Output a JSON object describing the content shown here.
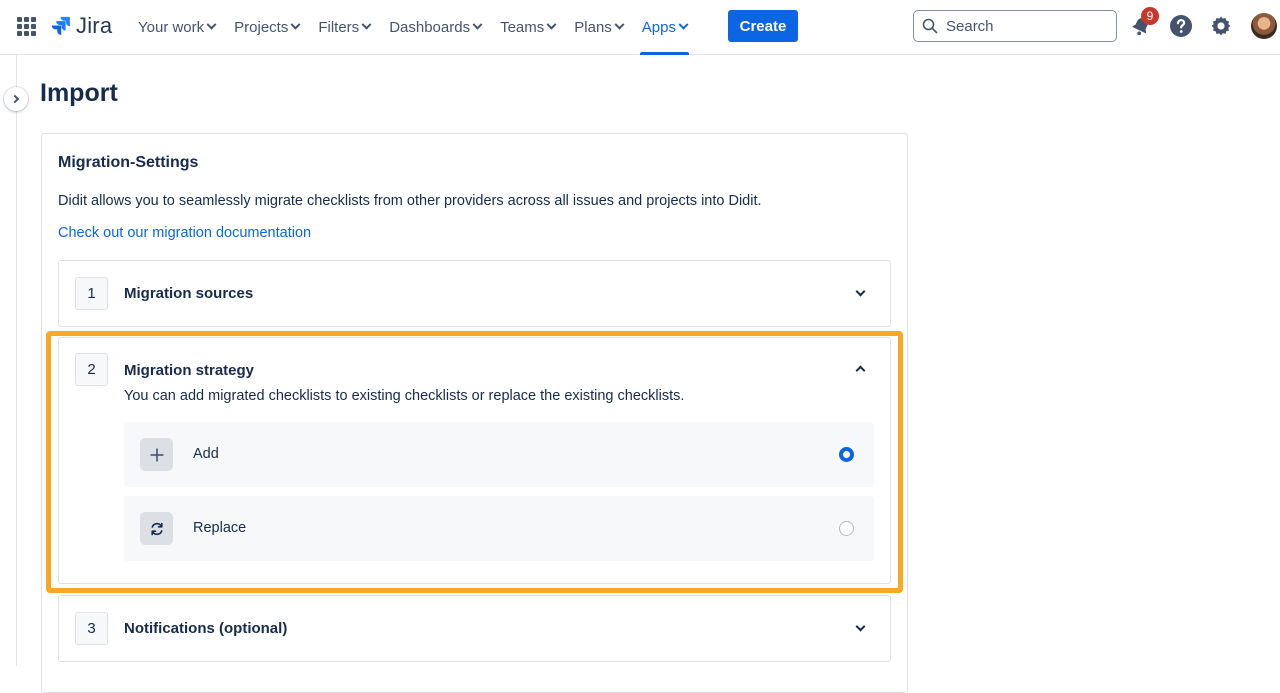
{
  "nav": {
    "apps_icon": "app-switcher-grid-icon",
    "logo_text": "Jira",
    "items": [
      {
        "label": "Your work",
        "active": false
      },
      {
        "label": "Projects",
        "active": false
      },
      {
        "label": "Filters",
        "active": false
      },
      {
        "label": "Dashboards",
        "active": false
      },
      {
        "label": "Teams",
        "active": false
      },
      {
        "label": "Plans",
        "active": false
      },
      {
        "label": "Apps",
        "active": true
      }
    ],
    "create_label": "Create",
    "search_placeholder": "Search",
    "notifications_count": "9",
    "accent_color": "#0c66e4",
    "badge_color": "#c9372c"
  },
  "page": {
    "title": "Import"
  },
  "card": {
    "title": "Migration-Settings",
    "description": "Didit allows you to seamlessly migrate checklists from other providers across all issues and projects into Didit.",
    "link_text": "Check out our migration documentation"
  },
  "steps": [
    {
      "number": "1",
      "title": "Migration sources",
      "expanded": false
    },
    {
      "number": "2",
      "title": "Migration strategy",
      "expanded": true,
      "description": "You can add migrated checklists to existing checklists or replace the existing checklists.",
      "options": [
        {
          "label": "Add",
          "icon": "plus-icon",
          "selected": true
        },
        {
          "label": "Replace",
          "icon": "refresh-icon",
          "selected": false
        }
      ]
    },
    {
      "number": "3",
      "title": "Notifications (optional)",
      "expanded": false
    }
  ],
  "highlight_color": "#f9a825"
}
